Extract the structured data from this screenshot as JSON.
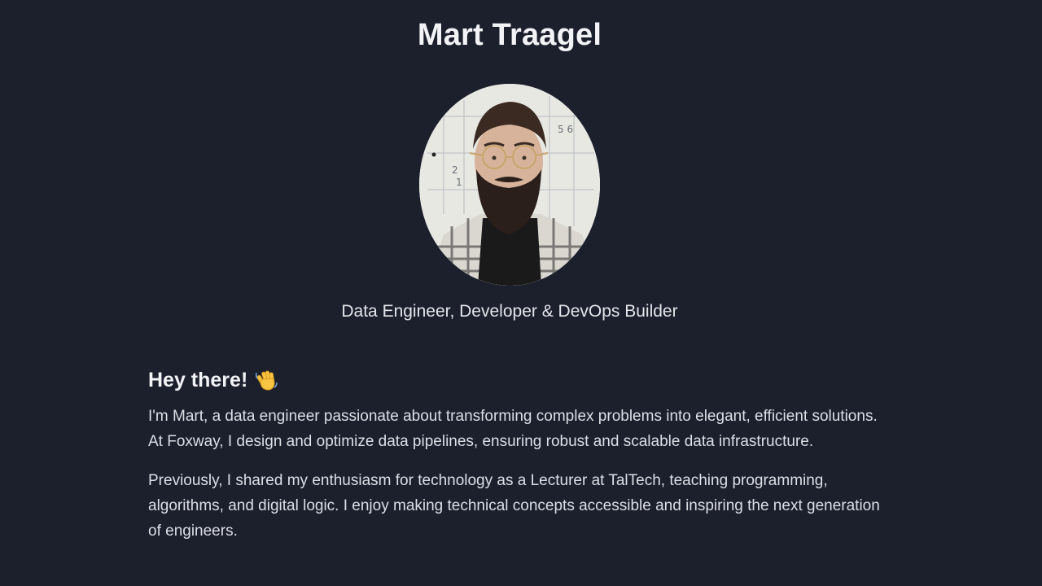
{
  "header": {
    "name": "Mart Traagel",
    "subtitle": "Data Engineer, Developer & DevOps Builder"
  },
  "avatar": {
    "icon": "profile-photo"
  },
  "about": {
    "greeting": "Hey there!",
    "greeting_icon": "waving-hand-icon",
    "paragraphs": [
      "I'm Mart, a data engineer passionate about transforming complex problems into elegant, efficient solutions. At Foxway, I design and optimize data pipelines, ensuring robust and scalable data infrastructure.",
      "Previously, I shared my enthusiasm for technology as a Lecturer at TalTech, teaching programming, algorithms, and digital logic. I enjoy making technical concepts accessible and inspiring the next generation of engineers."
    ]
  },
  "colors": {
    "background": "#1c202d",
    "text": "#e6e8ee"
  }
}
